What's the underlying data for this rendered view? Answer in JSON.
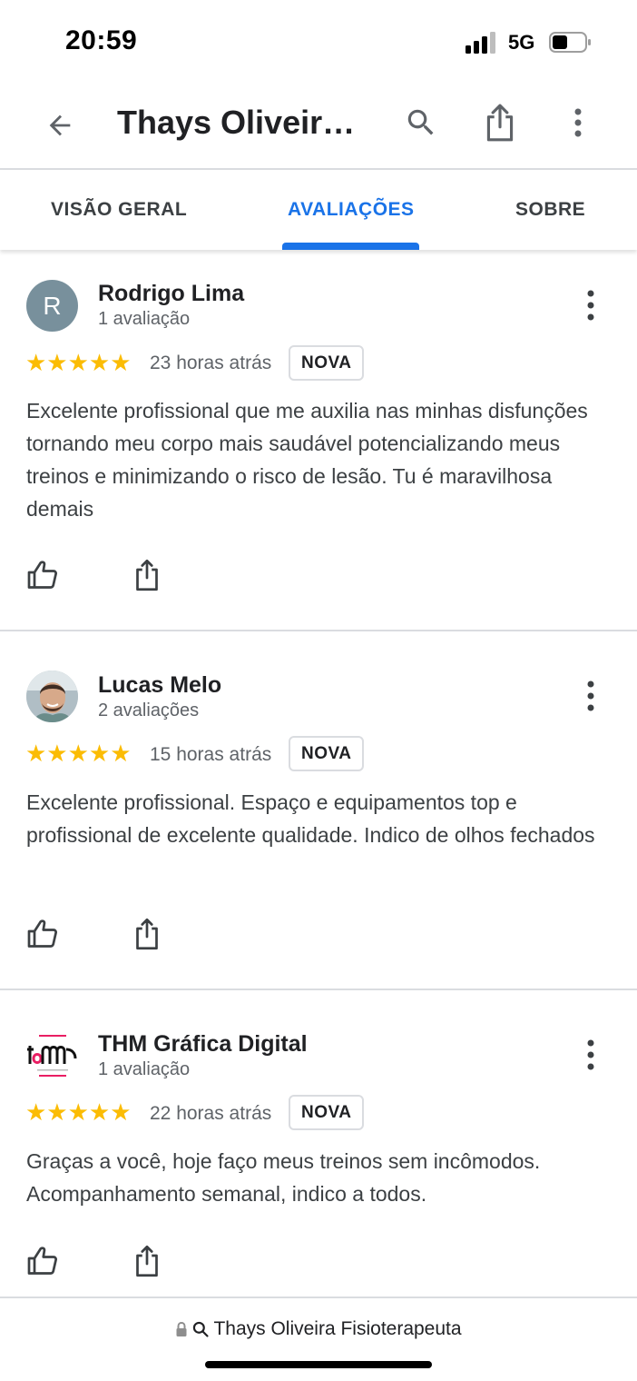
{
  "status_bar": {
    "time": "20:59",
    "network": "5G"
  },
  "app_bar": {
    "title": "Thays Oliveira Fisioterapeuta",
    "icons": [
      "back-arrow-icon",
      "search-icon",
      "share-icon",
      "more-vert-icon"
    ]
  },
  "tabs": [
    {
      "label": "VISÃO GERAL",
      "active": false
    },
    {
      "label": "AVALIAÇÕES",
      "active": true
    },
    {
      "label": "SOBRE",
      "active": false
    }
  ],
  "reviews": [
    {
      "name": "Rodrigo Lima",
      "count": "1 avaliação",
      "avatar_letter": "R",
      "rating": 5,
      "stars": "★★★★★",
      "time": "23 horas atrás",
      "badge": "NOVA",
      "text": "Excelente profissional que me auxilia nas minhas disfunções tornando meu corpo mais saudável potencializando meus treinos e minimizando o risco de lesão. Tu é maravilhosa demais"
    },
    {
      "name": "Lucas Melo",
      "count": "2 avaliações",
      "rating": 5,
      "stars": "★★★★★",
      "time": "15 horas atrás",
      "badge": "NOVA",
      "text": "Excelente profissional. Espaço e equipamentos top e profissional de excelente qualidade. Indico de olhos fechados"
    },
    {
      "name": "THM Gráfica Digital",
      "count": "1 avaliação",
      "rating": 5,
      "stars": "★★★★★",
      "time": "22 horas atrás",
      "badge": "NOVA",
      "text": "Graças a você, hoje faço meus treinos sem incômodos. Acompanhamento semanal, indico a todos."
    }
  ],
  "url_bar": {
    "text": "Thays Oliveira Fisioterapeuta"
  },
  "colors": {
    "accent": "#1a73e8",
    "star": "#fbbc04",
    "divider": "#dadce0",
    "text_secondary": "#5f6368"
  }
}
